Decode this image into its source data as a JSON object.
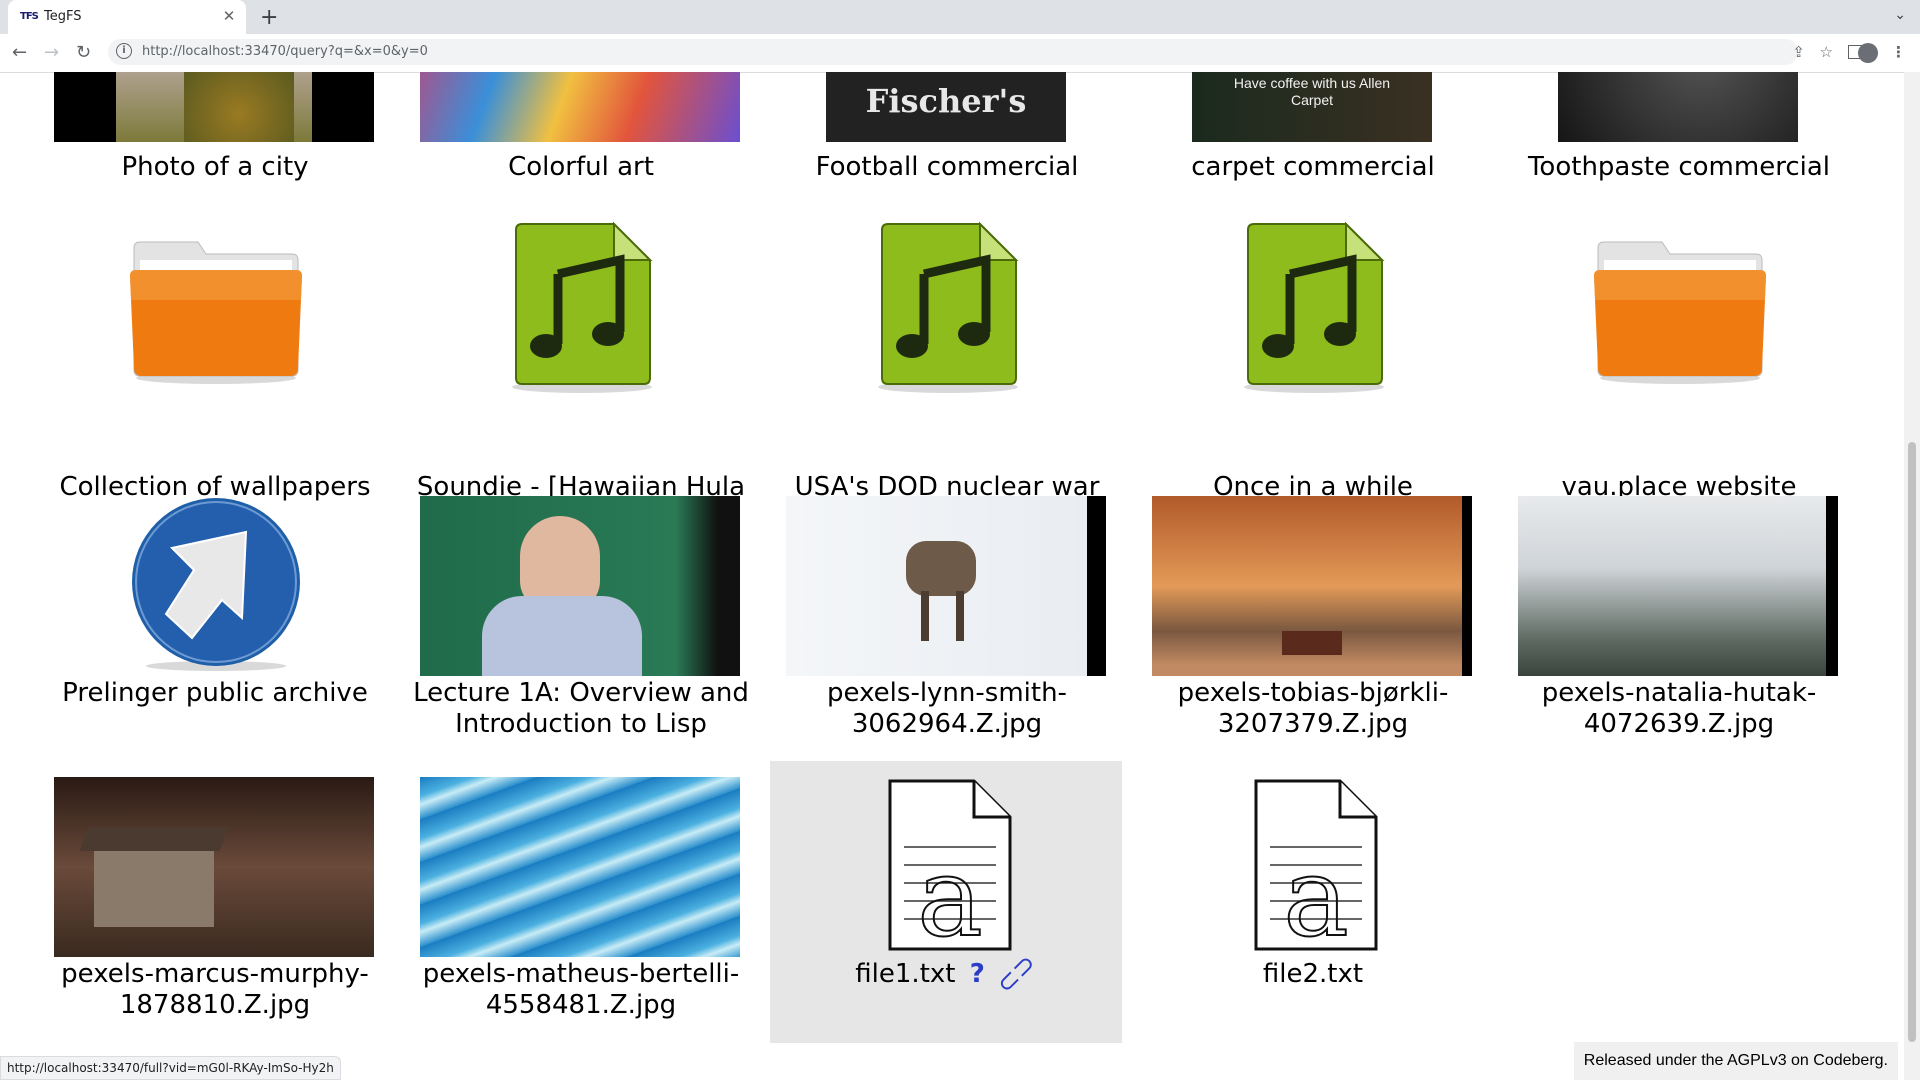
{
  "browser": {
    "tab_title": "TegFS",
    "tab_favicon": "TFS",
    "url": "http://localhost:33470/query?q=&x=0&y=0",
    "status_url": "http://localhost:33470/full?vid=mG0l-RKAy-ImSo-Hy2h"
  },
  "footer": {
    "text": "Released under the AGPLv3 on Codeberg."
  },
  "items": [
    {
      "label": "Photo of a city",
      "kind": "image"
    },
    {
      "label": "Colorful art",
      "kind": "image"
    },
    {
      "label": "Football commercial",
      "kind": "image",
      "overlay": "Fischer's"
    },
    {
      "label": "carpet commercial",
      "kind": "image",
      "overlay": "Have coffee with us Allen Carpet"
    },
    {
      "label": "Toothpaste commercial",
      "kind": "image"
    },
    {
      "label": "Collection of wallpapers",
      "kind": "folder-icon"
    },
    {
      "label": "Soundie - [Hawaiian Hula Song]",
      "kind": "music-file-icon"
    },
    {
      "label": "USA's DOD nuclear war ASMR",
      "kind": "music-file-icon"
    },
    {
      "label": "Once in a while",
      "kind": "music-file-icon"
    },
    {
      "label": "vau.place website",
      "kind": "folder-icon"
    },
    {
      "label": "Prelinger public archive",
      "kind": "link-arrow-icon"
    },
    {
      "label": "Lecture 1A: Overview and Introduction to Lisp",
      "kind": "image"
    },
    {
      "label": "pexels-lynn-smith-3062964.Z.jpg",
      "kind": "image"
    },
    {
      "label": "pexels-tobias-bjørkli-3207379.Z.jpg",
      "kind": "image"
    },
    {
      "label": "pexels-natalia-hutak-4072639.Z.jpg",
      "kind": "image"
    },
    {
      "label": "pexels-marcus-murphy-1878810.Z.jpg",
      "kind": "image"
    },
    {
      "label": "pexels-matheus-bertelli-4558481.Z.jpg",
      "kind": "image"
    },
    {
      "label": "file1.txt",
      "kind": "text-file-icon",
      "selected": true,
      "actions": [
        "help-icon",
        "link-icon"
      ]
    },
    {
      "label": "file2.txt",
      "kind": "text-file-icon"
    }
  ]
}
